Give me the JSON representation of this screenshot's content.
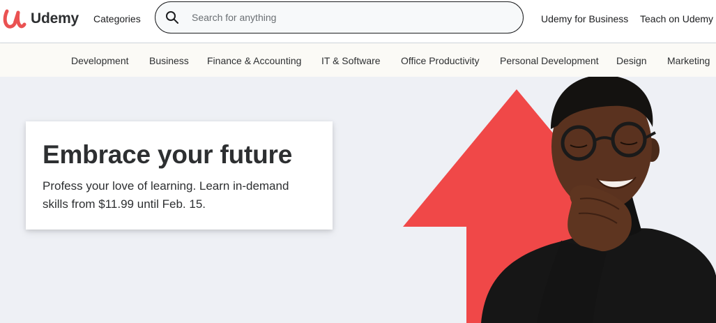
{
  "header": {
    "logo_text": "Udemy",
    "categories_label": "Categories",
    "search_placeholder": "Search for anything",
    "business_link": "Udemy for Business",
    "teach_link": "Teach on Udemy"
  },
  "category_nav": {
    "items": [
      "Development",
      "Business",
      "Finance & Accounting",
      "IT & Software",
      "Office Productivity",
      "Personal Development",
      "Design",
      "Marketing"
    ]
  },
  "hero": {
    "headline": "Embrace your future",
    "subtext": "Profess your love of learning. Learn in-demand skills from $11.99 until Feb. 15."
  },
  "colors": {
    "brand": "#ea5252",
    "arrow": "#f04848",
    "hero_bg": "#eef0f5",
    "text": "#1c1d1f"
  },
  "icons": [
    "udemy-logo-icon",
    "search-icon"
  ]
}
